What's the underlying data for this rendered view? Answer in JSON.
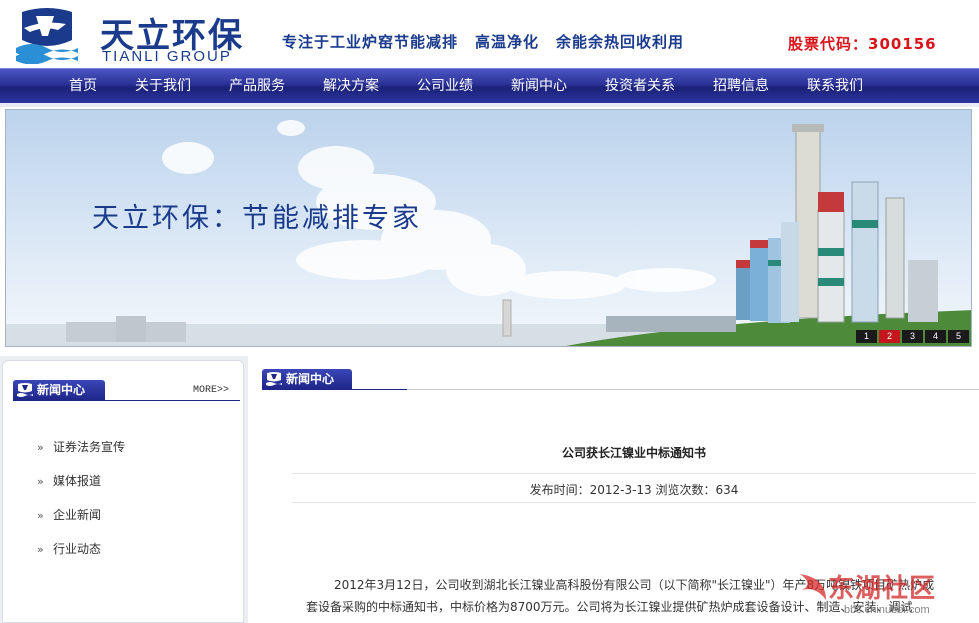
{
  "header": {
    "logo_cn": "天立环保",
    "logo_en": "TIANLI GROUP",
    "slogans": [
      "专注于工业炉窑节能减排",
      "高温净化",
      "余能余热回收利用"
    ],
    "stock_code": "股票代码：300156"
  },
  "nav": {
    "items": [
      "首页",
      "关于我们",
      "产品服务",
      "解决方案",
      "公司业绩",
      "新闻中心",
      "投资者关系",
      "招聘信息",
      "联系我们"
    ]
  },
  "banner": {
    "title": "天立环保：节能减排专家",
    "pager": [
      "1",
      "2",
      "3",
      "4",
      "5"
    ],
    "active_page": "2"
  },
  "sidebar": {
    "section_title": "新闻中心",
    "more": "MORE>>",
    "arrow": "»",
    "items": [
      "证券法务宣传",
      "媒体报道",
      "企业新闻",
      "行业动态"
    ]
  },
  "main": {
    "section_title": "新闻中心",
    "article_title": "公司获长江镍业中标通知书",
    "meta": "发布时间：2012-3-13 浏览次数：634",
    "paragraph1": "2012年3月12日，公司收到湖北长江镍业高科股份有限公司（以下简称\"长江镍业\"）年产8万吨镍铁项目矿热炉成",
    "paragraph2": "套设备采购的中标通知书，中标价格为8700万元。公司将为长江镍业提供矿热炉成套设备设计、制造、安装、调试"
  },
  "watermark": {
    "text": "东湖社区",
    "url": "bbs.chinubei.com"
  },
  "colors": {
    "brand_blue": "#1a3a8c",
    "nav_blue": "#2a3195",
    "stock_red": "#d9141a",
    "pager_active": "#c4161c"
  }
}
